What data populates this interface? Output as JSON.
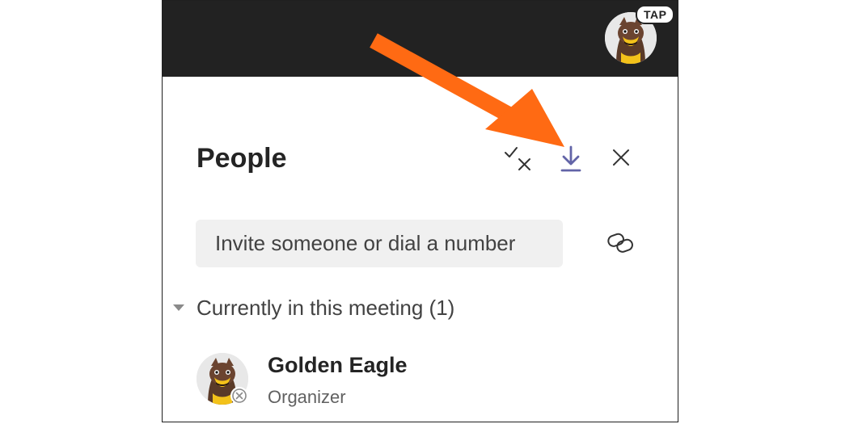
{
  "topbar": {
    "tap_badge": "TAP",
    "avatar_icon": "eagle-mascot-avatar"
  },
  "panel": {
    "title": "People",
    "actions": [
      {
        "name": "manage-permissions",
        "icon": "check-cross-icon"
      },
      {
        "name": "download-attendance",
        "icon": "download-icon",
        "color": "#6264a7"
      },
      {
        "name": "close",
        "icon": "close-icon"
      }
    ],
    "invite": {
      "placeholder": "Invite someone or dial a number",
      "value": ""
    },
    "link_icon": "link-icon"
  },
  "section": {
    "title": "Currently in this meeting (1)"
  },
  "participants": [
    {
      "name": "Golden Eagle",
      "role": "Organizer",
      "presence_icon": "offline-presence-icon"
    }
  ],
  "annotation": {
    "arrow_color": "#ff6a13"
  }
}
